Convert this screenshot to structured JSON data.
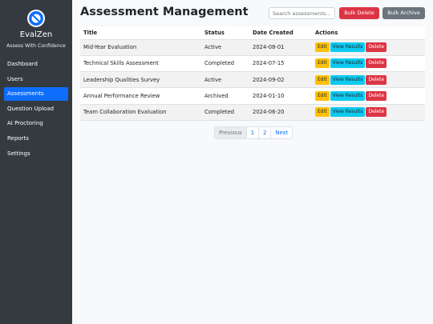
{
  "sidebar": {
    "brand": "EvalZen",
    "tagline": "Assess With Confidence",
    "items": [
      {
        "label": "Dashboard"
      },
      {
        "label": "Users"
      },
      {
        "label": "Assessments",
        "active": true
      },
      {
        "label": "Question Upload"
      },
      {
        "label": "AI Proctoring"
      },
      {
        "label": "Reports"
      },
      {
        "label": "Settings"
      }
    ]
  },
  "header": {
    "title": "Assessment Management",
    "search_placeholder": "Search assessments...",
    "bulk_delete": "Bulk Delete",
    "bulk_archive": "Bulk Archive"
  },
  "table": {
    "columns": [
      "Title",
      "Status",
      "Date Created",
      "Actions"
    ],
    "rows": [
      {
        "title": "Mid-Year Evaluation",
        "status": "Active",
        "date": "2024-08-01"
      },
      {
        "title": "Technical Skills Assessment",
        "status": "Completed",
        "date": "2024-07-15"
      },
      {
        "title": "Leadership Qualities Survey",
        "status": "Active",
        "date": "2024-09-02"
      },
      {
        "title": "Annual Performance Review",
        "status": "Archived",
        "date": "2024-01-10"
      },
      {
        "title": "Team Collaboration Evaluation",
        "status": "Completed",
        "date": "2024-06-20"
      }
    ],
    "actions": {
      "edit": "Edit",
      "view": "View Results",
      "delete": "Delete"
    }
  },
  "pagination": {
    "previous": "Previous",
    "pages": [
      "1",
      "2"
    ],
    "next": "Next"
  },
  "colors": {
    "sidebar_bg": "#343a40",
    "active": "#0d6efd",
    "danger": "#dc3545",
    "secondary": "#6c757d",
    "warning": "#ffc107",
    "info": "#0dcaf0"
  }
}
